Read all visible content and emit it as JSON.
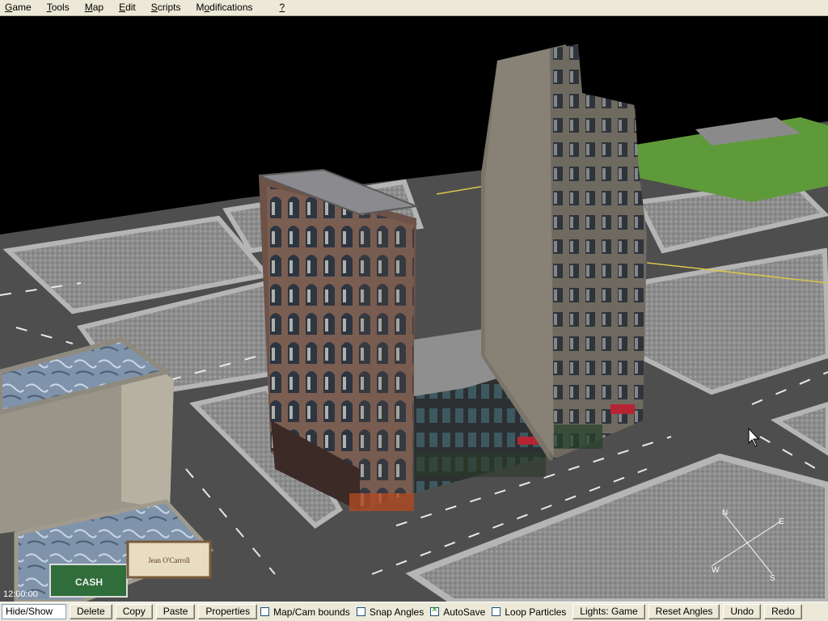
{
  "menu": {
    "items": [
      {
        "pre": "",
        "u": "G",
        "post": "ame"
      },
      {
        "pre": "",
        "u": "T",
        "post": "ools"
      },
      {
        "pre": "",
        "u": "M",
        "post": "ap"
      },
      {
        "pre": "",
        "u": "E",
        "post": "dit"
      },
      {
        "pre": "",
        "u": "S",
        "post": "cripts"
      },
      {
        "pre": "M",
        "u": "o",
        "post": "difications"
      },
      {
        "pre": "",
        "u": "?",
        "post": ""
      }
    ]
  },
  "viewport": {
    "clock": "12:00:00",
    "compass": {
      "n": "N",
      "e": "E",
      "s": "S",
      "w": "W"
    },
    "signs": {
      "store_left": "CASH",
      "store_right": "Jean O'Carroll"
    }
  },
  "toolbar": {
    "hide_show": "Hide/Show",
    "delete": "Delete",
    "copy": "Copy",
    "paste": "Paste",
    "properties": "Properties",
    "map_cam_bounds": {
      "label": "Map/Cam bounds",
      "checked": false
    },
    "snap_angles": {
      "label": "Snap Angles",
      "checked": false
    },
    "autosave": {
      "label": "AutoSave",
      "checked": true
    },
    "loop_particles": {
      "label": "Loop Particles",
      "checked": false
    },
    "lights": "Lights: Game",
    "reset_angles": "Reset Angles",
    "undo": "Undo",
    "redo": "Redo"
  }
}
